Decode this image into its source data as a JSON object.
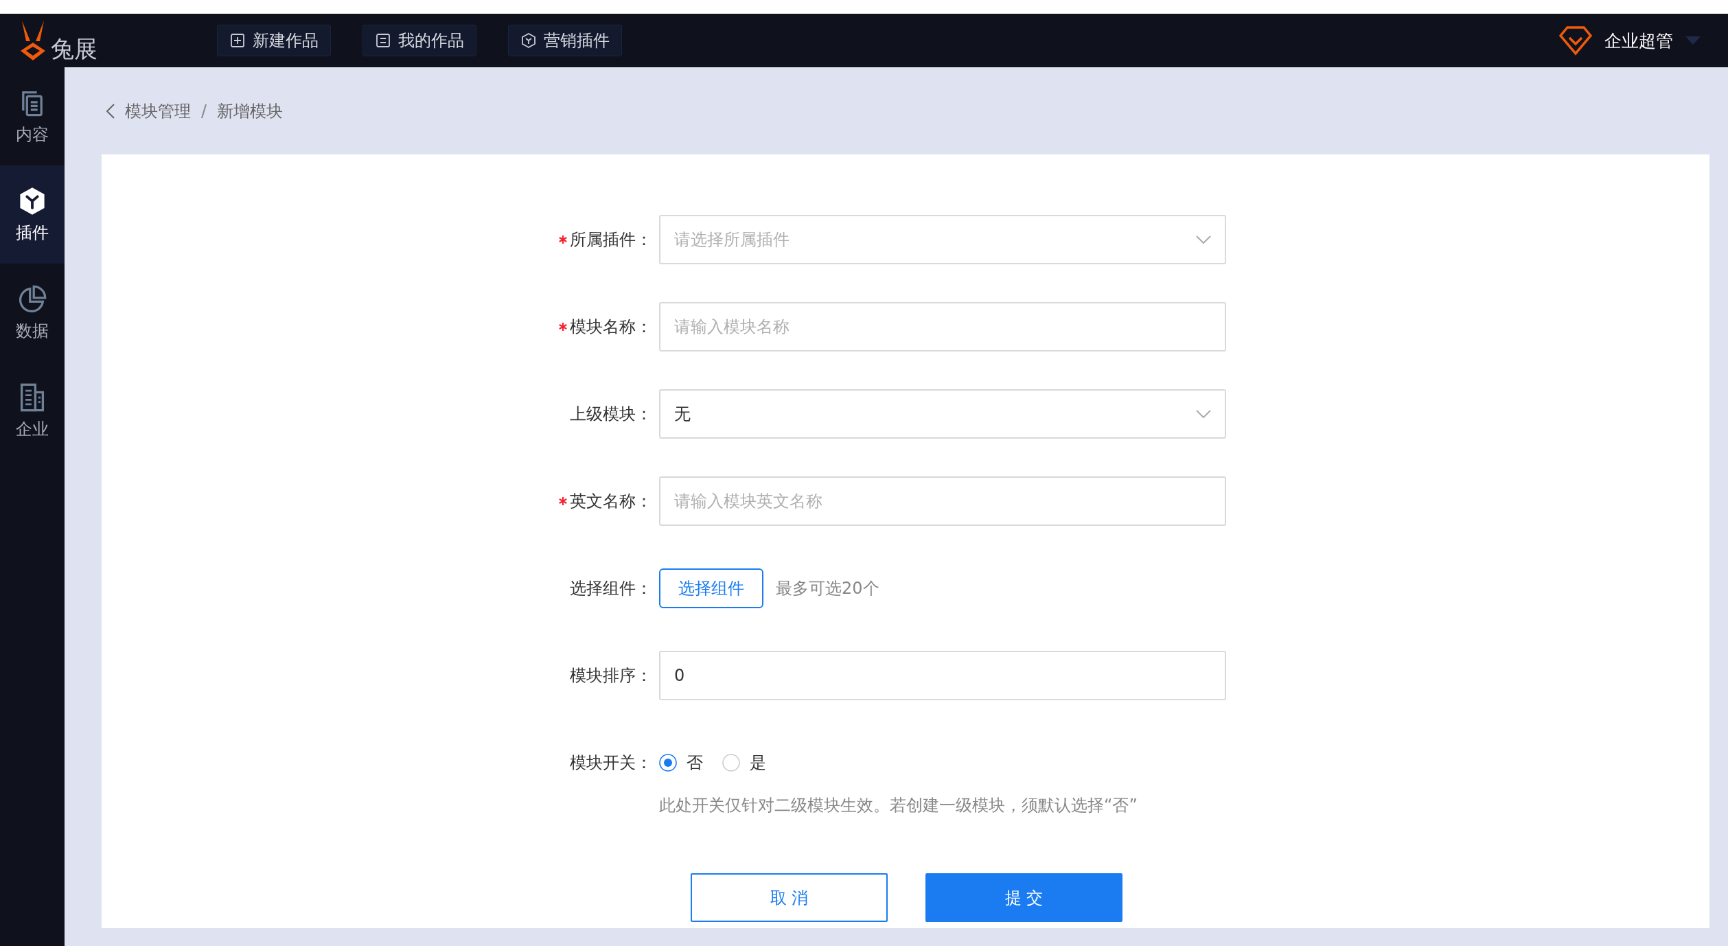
{
  "header": {
    "logo_text": "兔展",
    "nav_buttons": [
      {
        "label": "新建作品"
      },
      {
        "label": "我的作品"
      },
      {
        "label": "营销插件"
      }
    ],
    "user": {
      "name": "企业超管"
    }
  },
  "sidebar": {
    "items": [
      {
        "label": "内容",
        "selected": false
      },
      {
        "label": "插件",
        "selected": true
      },
      {
        "label": "数据",
        "selected": false
      },
      {
        "label": "企业",
        "selected": false
      }
    ]
  },
  "breadcrumb": [
    "模块管理",
    "新增模块"
  ],
  "form": {
    "fields": [
      {
        "kind": "select",
        "label": "所属插件：",
        "required": true,
        "placeholder": "请选择所属插件"
      },
      {
        "kind": "input",
        "label": "模块名称：",
        "required": true,
        "placeholder": "请输入模块名称"
      },
      {
        "kind": "select",
        "label": "上级模块：",
        "required": false,
        "value": "无"
      },
      {
        "kind": "input",
        "label": "英文名称：",
        "required": true,
        "placeholder": "请输入模块英文名称"
      },
      {
        "kind": "picker",
        "label": "选择组件：",
        "required": false,
        "button": "选择组件",
        "hint": "最多可选20个"
      },
      {
        "kind": "input",
        "label": "模块排序：",
        "required": false,
        "value": "0"
      },
      {
        "kind": "radio",
        "label": "模块开关：",
        "required": false,
        "options": [
          {
            "label": "否",
            "selected": true
          },
          {
            "label": "是",
            "selected": false
          }
        ],
        "hint": "此处开关仅针对二级模块生效。若创建一级模块，须默认选择“否”"
      }
    ]
  },
  "actions": [
    {
      "label": "取 消",
      "kind": "secondary"
    },
    {
      "label": "提 交",
      "kind": "primary"
    }
  ]
}
